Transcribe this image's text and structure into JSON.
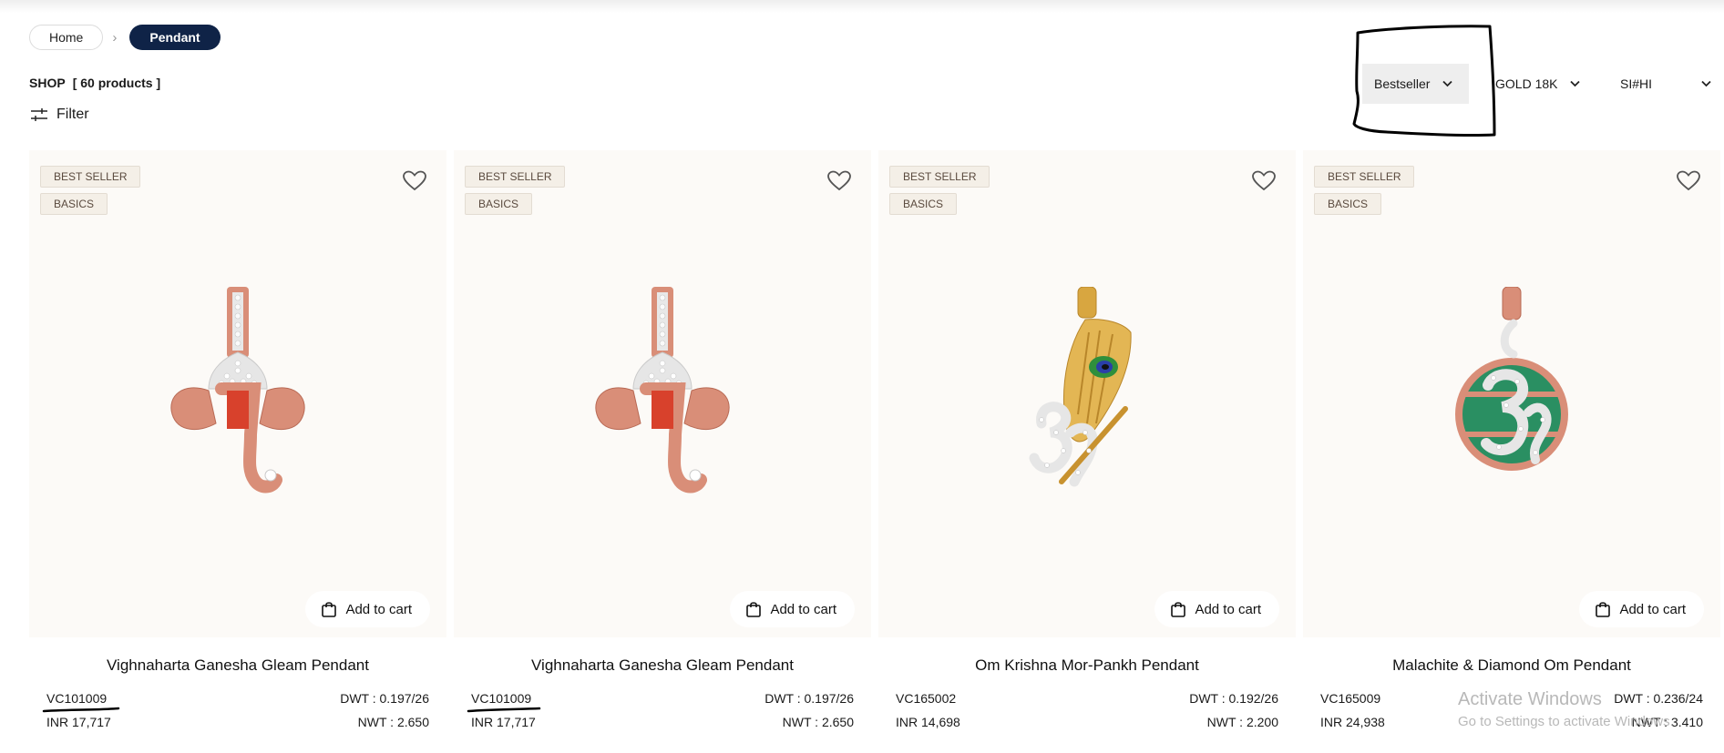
{
  "breadcrumb": {
    "home": "Home",
    "separator": "›",
    "current": "Pendant"
  },
  "shop": {
    "title": "SHOP",
    "count": "[ 60 products ]"
  },
  "filter": {
    "label": "Filter",
    "icon": "sliders-icon"
  },
  "sort": {
    "selected": "Bestseller",
    "icon": "chevron-down-icon"
  },
  "metal": {
    "selected": "GOLD 18K"
  },
  "quality": {
    "selected": "SI#HI"
  },
  "products": [
    {
      "badges": [
        "BEST SELLER",
        "BASICS"
      ],
      "name": "Vighnaharta Ganesha Gleam Pendant",
      "code": "VC101009",
      "price": "INR  17,717",
      "dwt": "DWT : 0.197/26",
      "nwt": "NWT : 2.650",
      "add_to_cart": "Add to cart",
      "image": "ganesha-pendant"
    },
    {
      "badges": [
        "BEST SELLER",
        "BASICS"
      ],
      "name": "Vighnaharta Ganesha Gleam Pendant",
      "code": "VC101009",
      "price": "INR  17,717",
      "dwt": "DWT : 0.197/26",
      "nwt": "NWT : 2.650",
      "add_to_cart": "Add to cart",
      "image": "ganesha-pendant"
    },
    {
      "badges": [
        "BEST SELLER",
        "BASICS"
      ],
      "name": "Om Krishna Mor-Pankh Pendant",
      "code": "VC165002",
      "price": "INR  14,698",
      "dwt": "DWT : 0.192/26",
      "nwt": "NWT : 2.200",
      "add_to_cart": "Add to cart",
      "image": "om-peacock-feather-pendant"
    },
    {
      "badges": [
        "BEST SELLER",
        "BASICS"
      ],
      "name": "Malachite & Diamond Om Pendant",
      "code": "VC165009",
      "price": "INR  24,938",
      "dwt": "DWT : 0.236/24",
      "nwt": "NWT : 3.410",
      "add_to_cart": "Add to cart",
      "image": "malachite-om-pendant"
    }
  ],
  "overlay": {
    "activate_title": "Activate Windows",
    "activate_sub": "Go to Settings to activate Windows."
  },
  "colors": {
    "accent": "#0f2347",
    "card_bg": "#fcfaf7",
    "badge_bg": "#f4efe7",
    "rose_gold": "#d98e78",
    "enamel_red": "#d8412c",
    "malachite": "#2a8f62",
    "gold": "#d8a640"
  }
}
